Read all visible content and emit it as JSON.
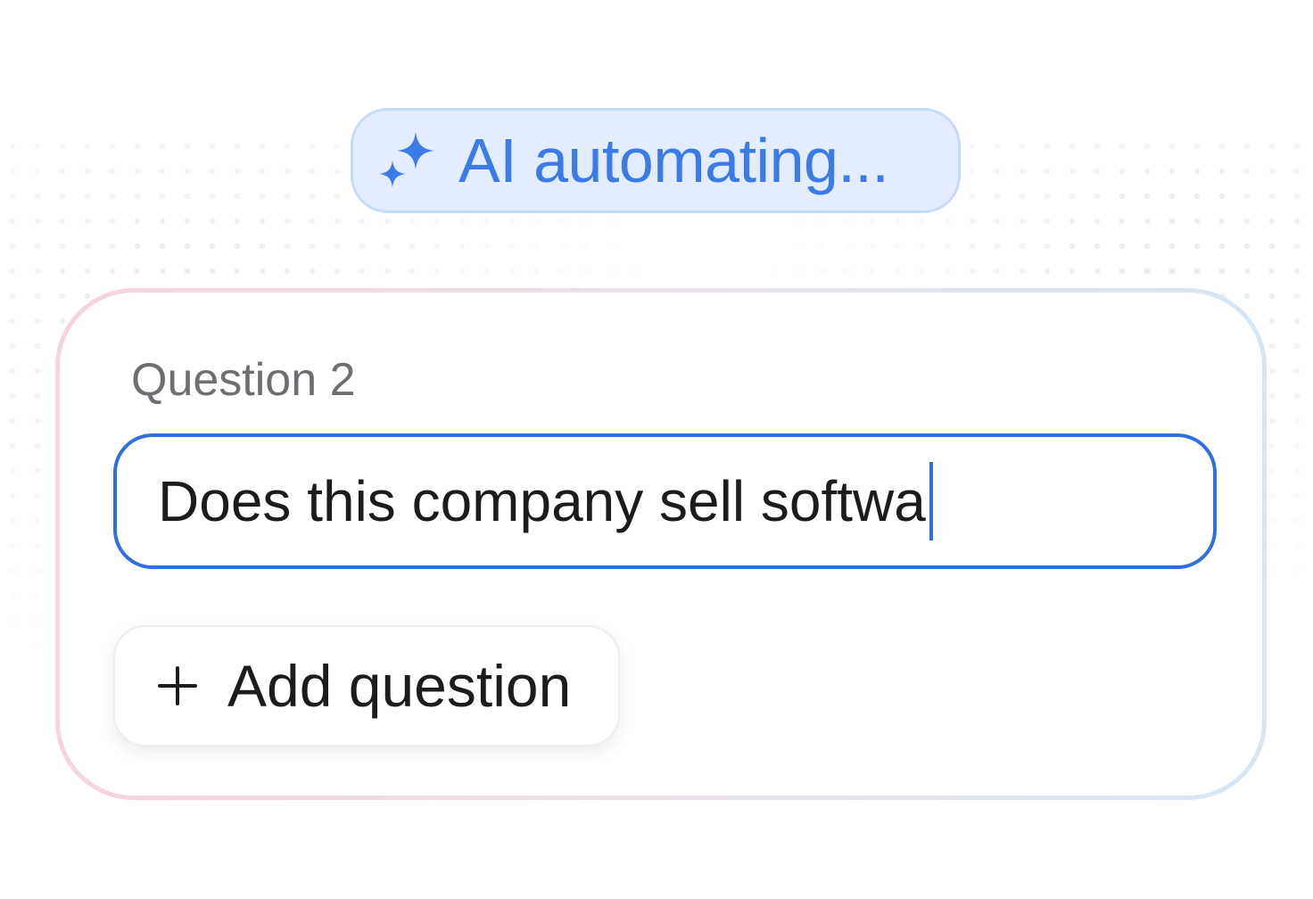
{
  "status_pill": {
    "icon": "sparkle-icon",
    "text": "AI automating...",
    "color": "#3b7be8",
    "background": "#e3edff"
  },
  "form": {
    "question_label": "Question 2",
    "question_input": {
      "value": "Does this company sell softwa",
      "focused": true,
      "border_color": "#2f6fe0"
    },
    "add_button": {
      "icon": "plus-icon",
      "label": "Add question"
    }
  }
}
